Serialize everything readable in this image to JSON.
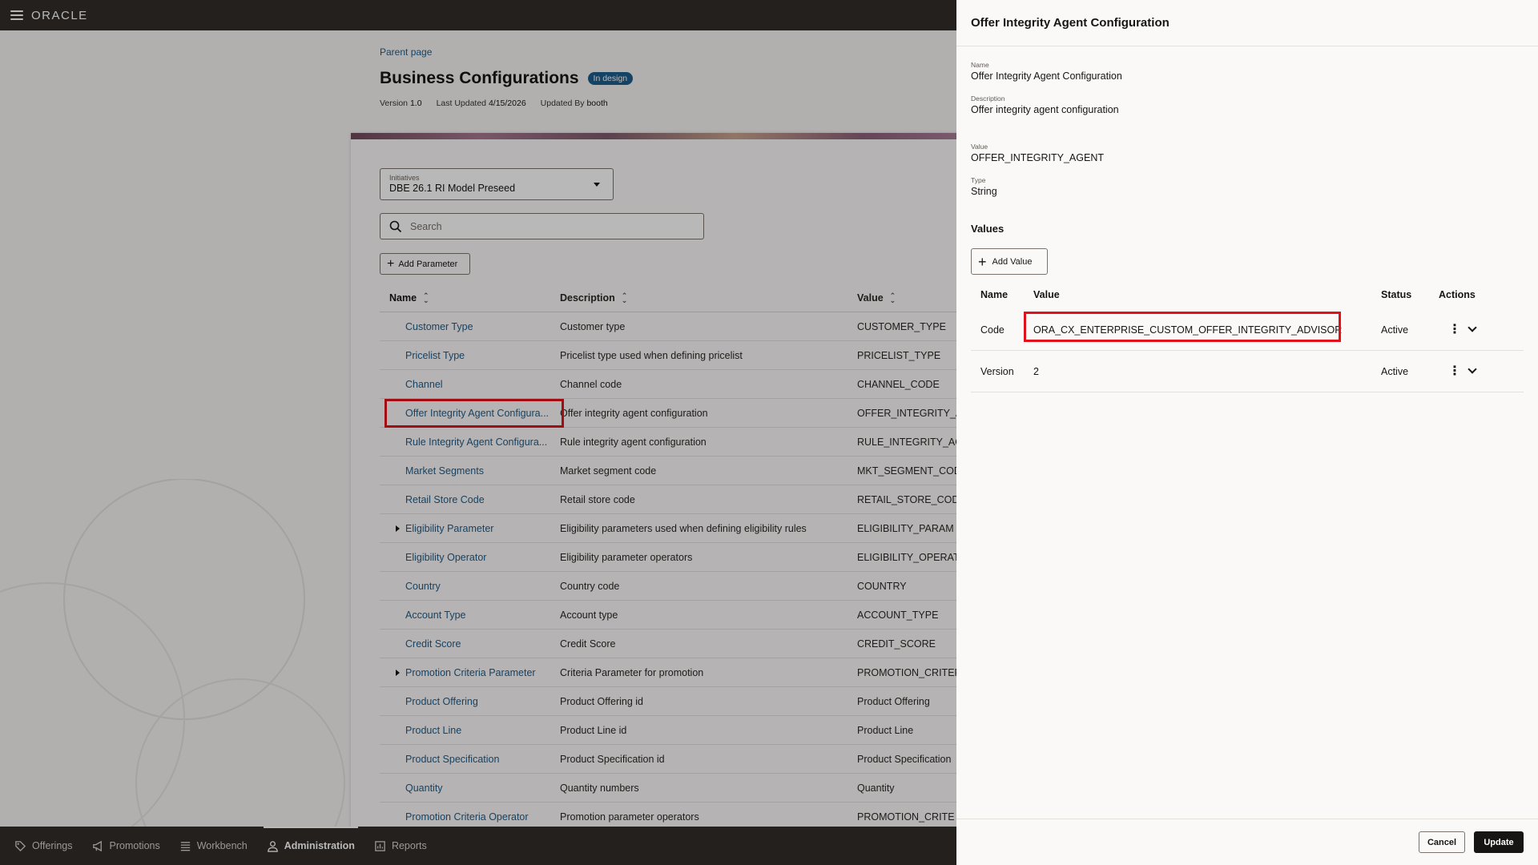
{
  "app": {
    "logo": "ORACLE"
  },
  "page": {
    "parent_link": "Parent page",
    "title": "Business Configurations",
    "status_badge": "In design",
    "version_label": "Version",
    "version_value": "1.0",
    "last_updated_label": "Last Updated",
    "last_updated_value": "4/15/2026",
    "updated_by_label": "Updated By",
    "updated_by_value": "booth"
  },
  "filters": {
    "initiatives_label": "Initiatives",
    "initiatives_value": "DBE 26.1 RI Model Preseed",
    "search_placeholder": "Search",
    "add_parameter_label": "Add Parameter"
  },
  "table": {
    "headers": {
      "name": "Name",
      "description": "Description",
      "value": "Value"
    },
    "rows": [
      {
        "name": "Customer Type",
        "description": "Customer type",
        "value": "CUSTOMER_TYPE"
      },
      {
        "name": "Pricelist Type",
        "description": "Pricelist type used when defining pricelist",
        "value": "PRICELIST_TYPE"
      },
      {
        "name": "Channel",
        "description": "Channel code",
        "value": "CHANNEL_CODE"
      },
      {
        "name": "Offer Integrity Agent Configura...",
        "description": "Offer integrity agent configuration",
        "value": "OFFER_INTEGRITY_A"
      },
      {
        "name": "Rule Integrity Agent Configura...",
        "description": "Rule integrity agent configuration",
        "value": "RULE_INTEGRITY_AG"
      },
      {
        "name": "Market Segments",
        "description": "Market segment code",
        "value": "MKT_SEGMENT_COD"
      },
      {
        "name": "Retail Store Code",
        "description": "Retail store code",
        "value": "RETAIL_STORE_COD"
      },
      {
        "name": "Eligibility Parameter",
        "description": "Eligibility parameters used when defining eligibility rules",
        "value": "ELIGIBILITY_PARAM"
      },
      {
        "name": "Eligibility Operator",
        "description": "Eligibility parameter operators",
        "value": "ELIGIBILITY_OPERAT"
      },
      {
        "name": "Country",
        "description": "Country code",
        "value": "COUNTRY"
      },
      {
        "name": "Account Type",
        "description": "Account type",
        "value": "ACCOUNT_TYPE"
      },
      {
        "name": "Credit Score",
        "description": "Credit Score",
        "value": "CREDIT_SCORE"
      },
      {
        "name": "Promotion Criteria Parameter",
        "description": "Criteria Parameter for promotion",
        "value": "PROMOTION_CRITER"
      },
      {
        "name": "Product Offering",
        "description": "Product Offering id",
        "value": "Product Offering"
      },
      {
        "name": "Product Line",
        "description": "Product Line id",
        "value": "Product Line"
      },
      {
        "name": "Product Specification",
        "description": "Product Specification id",
        "value": "Product Specification"
      },
      {
        "name": "Quantity",
        "description": "Quantity numbers",
        "value": "Quantity"
      },
      {
        "name": "Promotion Criteria Operator",
        "description": "Promotion parameter operators",
        "value": "PROMOTION_CRITE"
      }
    ]
  },
  "bottom_nav": {
    "items": [
      {
        "label": "Offerings"
      },
      {
        "label": "Promotions"
      },
      {
        "label": "Workbench"
      },
      {
        "label": "Administration"
      },
      {
        "label": "Reports"
      }
    ]
  },
  "drawer": {
    "title": "Offer Integrity Agent Configuration",
    "name_label": "Name",
    "name_value": "Offer Integrity Agent Configuration",
    "description_label": "Description",
    "description_value": "Offer integrity agent configuration",
    "value_label": "Value",
    "value_value": "OFFER_INTEGRITY_AGENT",
    "type_label": "Type",
    "type_value": "String",
    "values_heading": "Values",
    "add_value_label": "Add Value",
    "table_headers": {
      "name": "Name",
      "value": "Value",
      "status": "Status",
      "actions": "Actions"
    },
    "rows": [
      {
        "name": "Code",
        "value": "ORA_CX_ENTERPRISE_CUSTOM_OFFER_INTEGRITY_ADVISOR",
        "status": "Active"
      },
      {
        "name": "Version",
        "value": "2",
        "status": "Active"
      }
    ],
    "cancel_label": "Cancel",
    "update_label": "Update"
  },
  "icons": {
    "menu": "hamburger-menu-icon",
    "search": "search-icon",
    "add": "plus-icon",
    "sort": "sort-icon",
    "expand": "caret-right-icon",
    "row_actions": "kebab-menu-icon",
    "row_expand": "chevron-down-icon"
  },
  "colors": {
    "highlight": "#e0121b",
    "link": "#1d5d8c",
    "topbar": "#312d2a",
    "badge": "#1d5d8c"
  }
}
